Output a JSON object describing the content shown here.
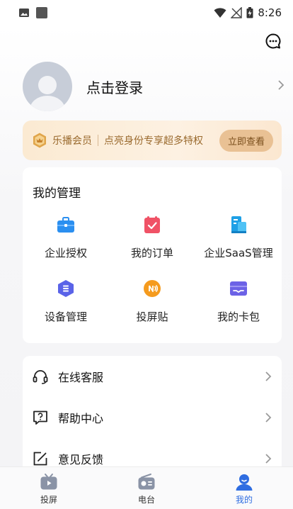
{
  "status_bar": {
    "time": "8:26"
  },
  "profile": {
    "login_text": "点击登录"
  },
  "vip": {
    "title": "乐播会员",
    "description": "点亮身份专享超多特权",
    "button": "立即查看"
  },
  "management": {
    "title": "我的管理",
    "items": [
      {
        "label": "企业授权",
        "icon": "briefcase-icon"
      },
      {
        "label": "我的订单",
        "icon": "order-clipboard-icon"
      },
      {
        "label": "企业SaaS管理",
        "icon": "building-icon"
      },
      {
        "label": "设备管理",
        "icon": "device-hexagon-icon"
      },
      {
        "label": "投屏贴",
        "icon": "nfc-sticker-icon"
      },
      {
        "label": "我的卡包",
        "icon": "card-wallet-icon"
      }
    ]
  },
  "services": {
    "items": [
      {
        "label": "在线客服",
        "icon": "headset-icon"
      },
      {
        "label": "帮助中心",
        "icon": "help-question-icon"
      },
      {
        "label": "意见反馈",
        "icon": "feedback-edit-icon"
      }
    ]
  },
  "tabs": [
    {
      "label": "投屏",
      "icon": "tv-play-icon",
      "active": false
    },
    {
      "label": "电台",
      "icon": "radio-icon",
      "active": false
    },
    {
      "label": "我的",
      "icon": "profile-icon",
      "active": true
    }
  ],
  "colors": {
    "accent": "#2f6de1",
    "vip_text": "#9a6a2e",
    "vip_button": "#e9c194"
  }
}
